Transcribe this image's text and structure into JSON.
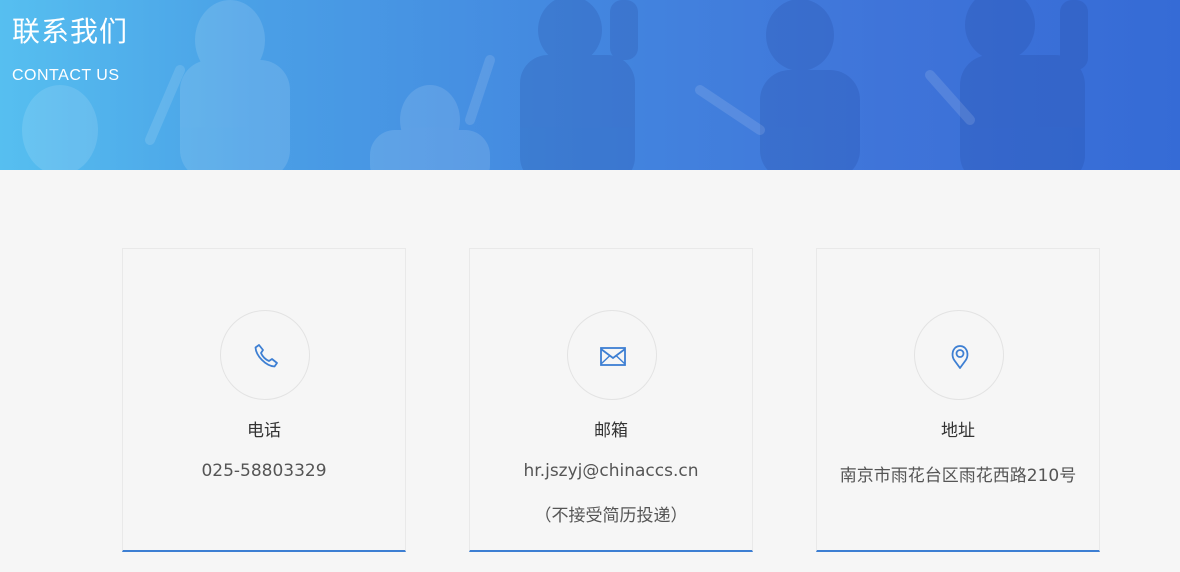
{
  "banner": {
    "title": "联系我们",
    "subtitle": "CONTACT US"
  },
  "contacts": [
    {
      "icon": "phone-icon",
      "label": "电话",
      "value": "025-58803329"
    },
    {
      "icon": "mail-icon",
      "label": "邮箱",
      "value": "hr.jszyj@chinaccs.cn",
      "note": "（不接受简历投递）"
    },
    {
      "icon": "location-pin-icon",
      "label": "地址",
      "value": "南京市雨花台区雨花西路210号"
    }
  ],
  "colors": {
    "accent": "#3d7fd3",
    "banner_start": "#56bff0",
    "banner_end": "#356bd6",
    "page_background": "#f6f6f6"
  }
}
